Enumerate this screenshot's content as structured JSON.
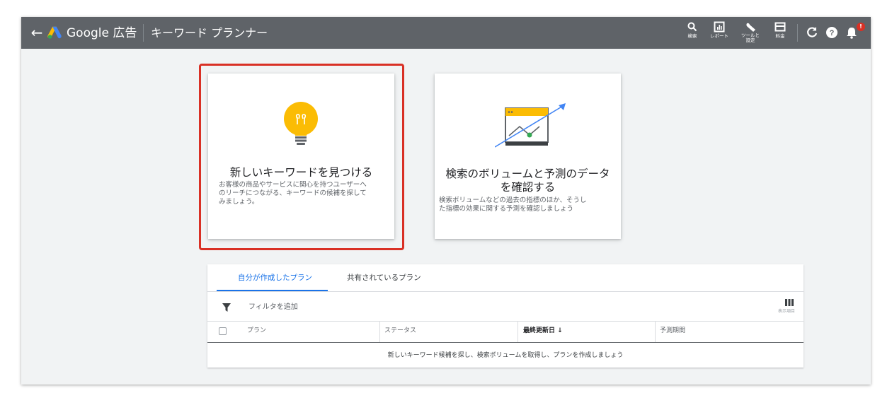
{
  "header": {
    "back_label": "←",
    "brand": "Google 広告",
    "page_title": "キーワード プランナー",
    "tools": [
      {
        "icon": "search-icon",
        "label": "検索"
      },
      {
        "icon": "report-icon",
        "label": "レポート"
      },
      {
        "icon": "wrench-icon",
        "label": "ツールと設定"
      },
      {
        "icon": "billing-icon",
        "label": "料金"
      }
    ],
    "right_icons": [
      "refresh-icon",
      "help-icon",
      "notifications-icon"
    ],
    "notification_badge": "!"
  },
  "cards": [
    {
      "icon": "lightbulb-icon",
      "title": "新しいキーワードを見つける",
      "description_lines": [
        "お客様の商品やサービスに関心を持つユーザーへ",
        "のリーチにつながる、キーワードの候補を探して",
        "みましょう。"
      ],
      "highlighted": true
    },
    {
      "icon": "forecast-chart-icon",
      "title_lines": [
        "検索のボリュームと予測のデータ",
        "を確認する"
      ],
      "description_lines": [
        "検索ボリュームなどの過去の指標のほか、そうし",
        "た指標の効果に関する予測を確認しましょう"
      ],
      "highlighted": false
    }
  ],
  "plans": {
    "tabs": [
      {
        "label": "自分が作成したプラン",
        "active": true
      },
      {
        "label": "共有されているプラン",
        "active": false
      }
    ],
    "filter_label": "フィルタを追加",
    "columns_label": "表示項目",
    "table_headers": [
      "プラン",
      "ステータス",
      "最終更新日 ↓",
      "予測期間"
    ],
    "empty_message": "新しいキーワード候補を探し、検索ボリュームを取得し、プランを作成しましょう"
  },
  "colors": {
    "topbar": "#5f6368",
    "accent_blue": "#1a73e8",
    "highlight_red": "#d93025",
    "bulb_yellow": "#fbbc04"
  }
}
